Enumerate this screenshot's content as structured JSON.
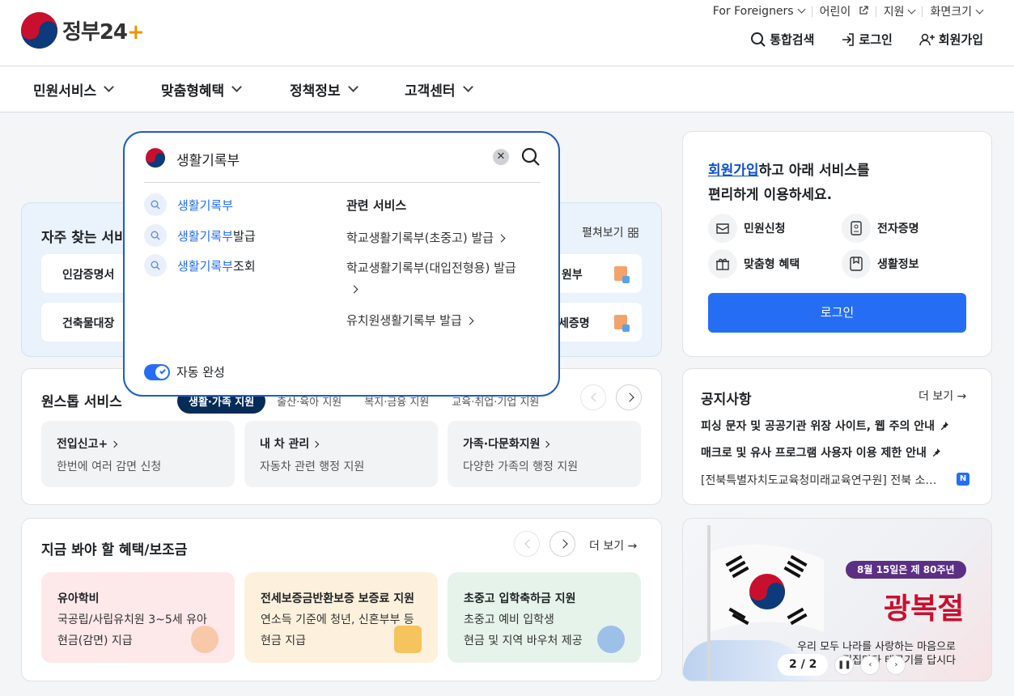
{
  "header": {
    "logo_text": "정부24",
    "util": [
      "For Foreigners",
      "어린이",
      "지원",
      "화면크기"
    ],
    "actions": {
      "search": "통합검색",
      "login": "로그인",
      "signup": "회원가입"
    }
  },
  "gnb": [
    "민원서비스",
    "맞춤형혜택",
    "정책정보",
    "고객센터"
  ],
  "frequent": {
    "title": "자주 찾는 서비스",
    "expand": "펼쳐보기",
    "items": [
      "인감증명서",
      "건축물대장",
      "원부",
      "세증명"
    ]
  },
  "onestop": {
    "title": "원스톱 서비스",
    "tabs": [
      "생활·가족 지원",
      "출산·육아 지원",
      "복지·금융 지원",
      "교육·취업·기업 지원"
    ],
    "cards": [
      {
        "title": "전입신고+",
        "desc": "한번에 여러 감면 신청"
      },
      {
        "title": "내 차 관리",
        "desc": "자동차 관련 행정 지원"
      },
      {
        "title": "가족·다문화지원",
        "desc": "다양한 가족의 행정 지원"
      }
    ]
  },
  "benefits": {
    "title": "지금 봐야 할 혜택/보조금",
    "more": "더 보기",
    "cards": [
      {
        "title": "유아학비",
        "line1": "국공립/사립유치원 3~5세 유아",
        "line2": "현금(감면) 지급"
      },
      {
        "title": "전세보증금반환보증 보증료 지원",
        "line1": "연소득 기준에 청년, 신혼부부 등",
        "line2": "현금 지급"
      },
      {
        "title": "초중고 입학축하금 지원",
        "line1": "초중고 예비 입학생",
        "line2": "현금 및 지역 바우처 제공"
      }
    ]
  },
  "login_card": {
    "link": "회원가입",
    "line1_rest": "하고 아래 서비스를",
    "line2": "편리하게 이용하세요.",
    "quick": [
      "민원신청",
      "전자증명",
      "맞춤형 혜택",
      "생활정보"
    ],
    "button": "로그인"
  },
  "notice": {
    "title": "공지사항",
    "more": "더 보기",
    "items": [
      "피싱 문자 및 공공기관 위장 사이트, 웹 주의 안내",
      "매크로 및 유사 프로그램 사용자 이용 제한 안내",
      "[전북특별자치도교육청미래교육연구원] 전북 소…"
    ],
    "badge": "N"
  },
  "banner": {
    "pill": "8월 15일은 제 80주년",
    "headline": "광복절",
    "sub1": "우리 모두 나라를 사랑하는 마음으로",
    "sub2": "집집마다 태극기를 답시다",
    "pager": "2 / 2"
  },
  "search": {
    "query": "생활기록부",
    "suggestions": [
      {
        "hl": "생활기록부",
        "rest": ""
      },
      {
        "hl": "생활기록부",
        "rest": "발급"
      },
      {
        "hl": "생활기록부",
        "rest": "조회"
      }
    ],
    "related_title": "관련 서비스",
    "related": [
      "학교생활기록부(초중고) 발급",
      "학교생활기록부(대입전형용) 발급",
      "유치원생활기록부 발급"
    ],
    "autocomplete": "자동 완성"
  },
  "colors": {
    "primary": "#256ef4",
    "navy": "#052b57",
    "border_focus": "#1f5bcc"
  }
}
